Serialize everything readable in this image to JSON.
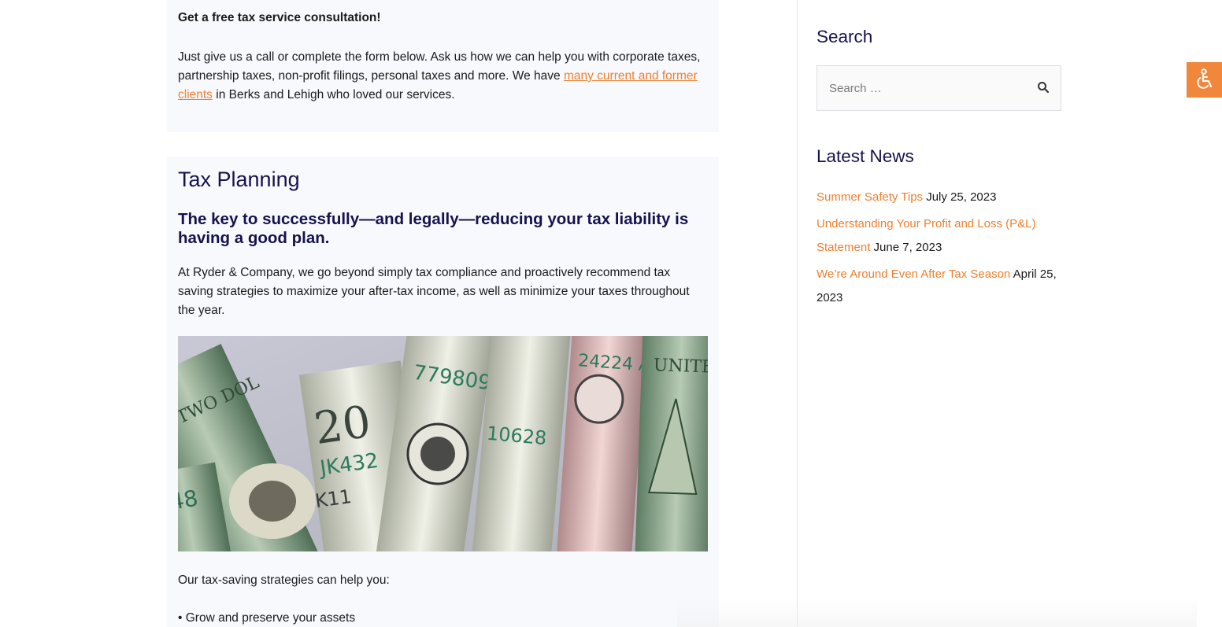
{
  "main": {
    "consult_heading": "Get a free tax service consultation!",
    "consult_text_1": "Just give us a call or complete the form below. Ask us how we can help you with corporate taxes, partnership taxes, non-profit filings, personal taxes and more. We have ",
    "consult_link": "many current and former clients",
    "consult_text_2": " in Berks and Lehigh who loved our services.",
    "section_title": "Tax Planning",
    "section_subtitle": "The key to successfully—and legally—reducing your tax liability is having a good plan.",
    "section_body": "At Ryder & Company, we go beyond simply tax compliance and proactively recommend tax saving strategies to maximize your after-tax income, as well as minimize your taxes throughout the year.",
    "image_icon": "rolled-dollar-bills-photo",
    "strategies_intro": "Our tax-saving strategies can help you:",
    "strategies": [
      "• Grow and preserve your assets"
    ]
  },
  "sidebar": {
    "search_title": "Search",
    "search_placeholder": "Search …",
    "search_icon": "search-icon",
    "news_title": "Latest News",
    "news": [
      {
        "title": "Summer Safety Tips",
        "date": "July 25, 2023"
      },
      {
        "title": "Understanding Your Profit and Loss (P&L) Statement",
        "date": "June 7, 2023"
      },
      {
        "title": "We’re Around Even After Tax Season",
        "date": "April 25, 2023"
      }
    ]
  },
  "accessibility": {
    "icon": "accessibility-icon",
    "color": "#f0873b"
  },
  "colors": {
    "link": "#ee7f2d",
    "heading": "#16124d",
    "card_bg": "#f8f9fd"
  }
}
